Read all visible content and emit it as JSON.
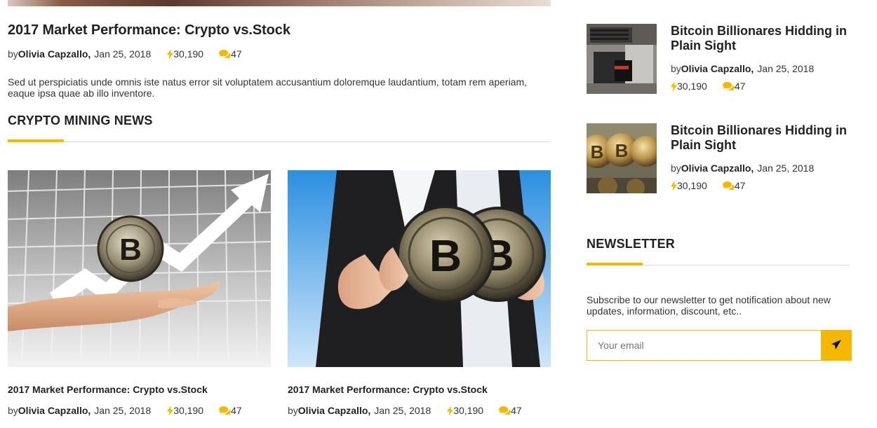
{
  "theme": {
    "accent": "#f5b800",
    "text": "#222222",
    "rule": "#d8d8d8"
  },
  "featured": {
    "title": "2017 Market Performance: Crypto vs.Stock",
    "by": "by",
    "author": "Olivia Capzallo,",
    "date": "Jan 25, 2018",
    "views": "30,190",
    "comments": "47",
    "excerpt": "Sed ut perspiciatis unde omnis iste natus error sit voluptatem accusantium doloremque laudantium, totam rem aperiam, eaque ipsa quae ab illo inventore."
  },
  "crypto_mining": {
    "heading": "CRYPTO MINING NEWS",
    "cards": [
      {
        "title": "2017 Market Performance: Crypto vs.Stock",
        "by": "by",
        "author": "Olivia Capzallo,",
        "date": "Jan 25, 2018",
        "views": "30,190",
        "comments": "47",
        "image": "hand-holding-bitcoin-rising-arrow"
      },
      {
        "title": "2017 Market Performance: Crypto vs.Stock",
        "by": "by",
        "author": "Olivia Capzallo,",
        "date": "Jan 25, 2018",
        "views": "30,190",
        "comments": "47",
        "image": "businessman-holding-two-bitcoins"
      }
    ]
  },
  "sidebar": {
    "posts": [
      {
        "title": "Bitcoin Billionares Hidding in Plain Sight",
        "by": "by",
        "author": "Olivia Capzallo,",
        "date": "Jan 25, 2018",
        "views": "30,190",
        "comments": "47",
        "image": "mining-rig-thumbnail"
      },
      {
        "title": "Bitcoin Billionares Hidding in Plain Sight",
        "by": "by",
        "author": "Olivia Capzallo,",
        "date": "Jan 25, 2018",
        "views": "30,190",
        "comments": "47",
        "image": "gold-bitcoins-thumbnail"
      }
    ],
    "newsletter": {
      "heading": "NEWSLETTER",
      "text": "Subscribe to our newsletter to get notification about new updates, information, discount, etc..",
      "placeholder": "Your email",
      "submit_icon": "paper-plane-icon"
    }
  }
}
